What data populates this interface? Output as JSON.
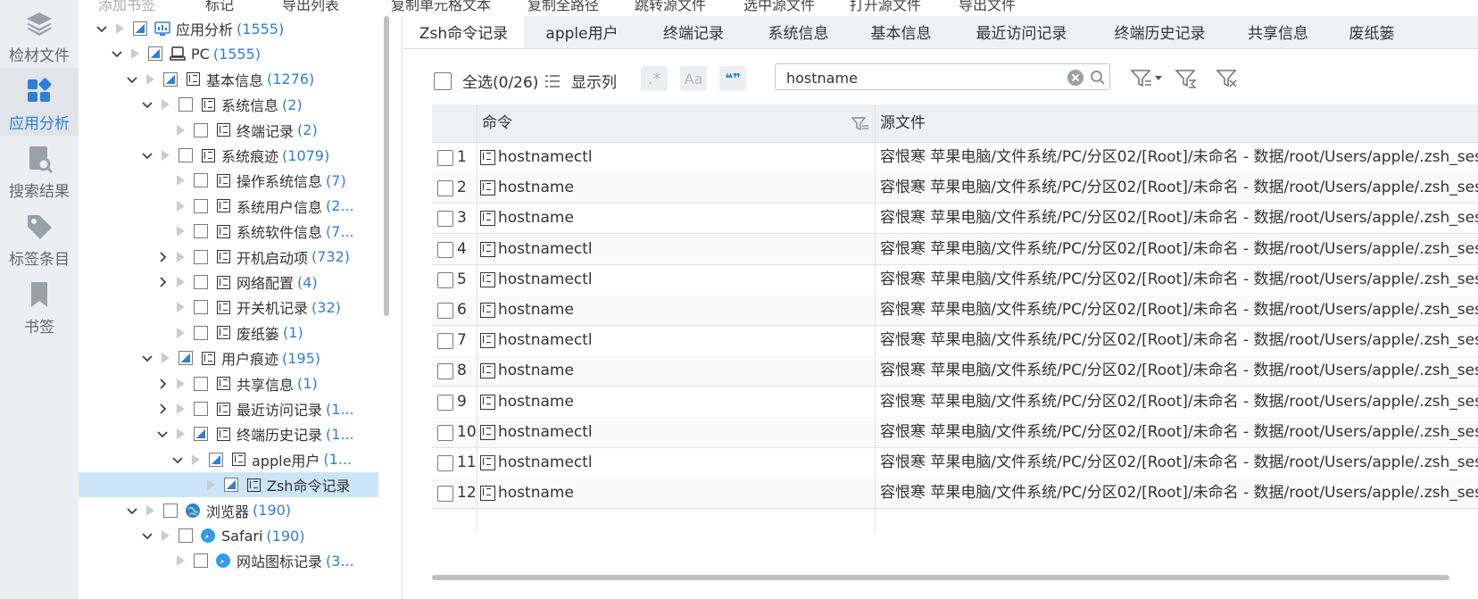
{
  "rail": [
    {
      "label": "检材文件",
      "icon": "layers-icon",
      "active": false
    },
    {
      "label": "应用分析",
      "icon": "grid-apps-icon",
      "active": true
    },
    {
      "label": "搜索结果",
      "icon": "search-doc-icon",
      "active": false
    },
    {
      "label": "标签条目",
      "icon": "tag-icon",
      "active": false
    },
    {
      "label": "书签",
      "icon": "bookmark-icon",
      "active": false
    }
  ],
  "top_menu": [
    "添加书签",
    "标记",
    "导出列表",
    "复制单元格文本",
    "复制全路径",
    "跳转源文件",
    "选中源文件",
    "打开源文件",
    "导出文件"
  ],
  "tree": [
    {
      "indent": 0,
      "expander": "down",
      "check": "partial",
      "icon": "app-analysis-icon",
      "label": "应用分析",
      "count": "(1555)"
    },
    {
      "indent": 1,
      "expander": "down",
      "check": "partial",
      "icon": "pc-icon",
      "label": "PC",
      "count": "(1555)"
    },
    {
      "indent": 2,
      "expander": "down",
      "check": "partial",
      "icon": "table-icon",
      "label": "基本信息",
      "count": "(1276)"
    },
    {
      "indent": 3,
      "expander": "down",
      "check": "none",
      "icon": "table-icon",
      "label": "系统信息",
      "count": "(2)"
    },
    {
      "indent": 4,
      "expander": "none",
      "check": "none",
      "icon": "table-icon",
      "label": "终端记录",
      "count": "(2)"
    },
    {
      "indent": 3,
      "expander": "down",
      "check": "none",
      "icon": "table-icon",
      "label": "系统痕迹",
      "count": "(1079)"
    },
    {
      "indent": 4,
      "expander": "none",
      "check": "none",
      "icon": "table-icon",
      "label": "操作系统信息",
      "count": "(7)"
    },
    {
      "indent": 4,
      "expander": "none",
      "check": "none",
      "icon": "table-icon",
      "label": "系统用户信息",
      "count": "(2..."
    },
    {
      "indent": 4,
      "expander": "none",
      "check": "none",
      "icon": "table-icon",
      "label": "系统软件信息",
      "count": "(7..."
    },
    {
      "indent": 4,
      "expander": "right",
      "check": "none",
      "icon": "table-icon",
      "label": "开机启动项",
      "count": "(732)"
    },
    {
      "indent": 4,
      "expander": "right",
      "check": "none",
      "icon": "table-icon",
      "label": "网络配置",
      "count": "(4)"
    },
    {
      "indent": 4,
      "expander": "none",
      "check": "none",
      "icon": "table-icon",
      "label": "开关机记录",
      "count": "(32)"
    },
    {
      "indent": 4,
      "expander": "none",
      "check": "none",
      "icon": "table-icon",
      "label": "废纸篓",
      "count": "(1)"
    },
    {
      "indent": 3,
      "expander": "down",
      "check": "partial",
      "icon": "table-icon",
      "label": "用户痕迹",
      "count": "(195)"
    },
    {
      "indent": 4,
      "expander": "right",
      "check": "none",
      "icon": "table-icon",
      "label": "共享信息",
      "count": "(1)"
    },
    {
      "indent": 4,
      "expander": "right",
      "check": "none",
      "icon": "table-icon",
      "label": "最近访问记录",
      "count": "(1..."
    },
    {
      "indent": 4,
      "expander": "down",
      "check": "partial",
      "icon": "table-icon",
      "label": "终端历史记录",
      "count": "(1..."
    },
    {
      "indent": 5,
      "expander": "down",
      "check": "partial",
      "icon": "table-icon",
      "label": "apple用户",
      "count": "(1..."
    },
    {
      "indent": 6,
      "expander": "none",
      "check": "partial",
      "icon": "table-icon",
      "label": "Zsh命令记录",
      "count": "",
      "selected": true
    },
    {
      "indent": 2,
      "expander": "down",
      "check": "none",
      "icon": "globe-icon",
      "label": "浏览器",
      "count": "(190)"
    },
    {
      "indent": 3,
      "expander": "down",
      "check": "none",
      "icon": "safari-icon",
      "label": "Safari",
      "count": "(190)"
    },
    {
      "indent": 4,
      "expander": "none",
      "check": "none",
      "icon": "safari-icon",
      "label": "网站图标记录",
      "count": "(3..."
    }
  ],
  "tabs": [
    "Zsh命令记录",
    "apple用户",
    "终端记录",
    "系统信息",
    "基本信息",
    "最近访问记录",
    "终端历史记录",
    "共享信息",
    "废纸篓"
  ],
  "active_tab": 0,
  "toolbar": {
    "select_all": "全选(0/26)",
    "show_columns": "显示列",
    "regex_glyph": ".*",
    "case_glyph": "Aa",
    "word_glyph": "❝❞"
  },
  "search": {
    "value": "hostname",
    "placeholder": ""
  },
  "grid": {
    "col_cmd": "命令",
    "col_src": "源文件",
    "rows": [
      {
        "n": "1",
        "cmd": "hostnamectl",
        "src": "容恨寒 苹果电脑/文件系统/PC/分区02/[Root]/未命名 - 数据/root/Users/apple/.zsh_sessio"
      },
      {
        "n": "2",
        "cmd": "hostname",
        "src": "容恨寒 苹果电脑/文件系统/PC/分区02/[Root]/未命名 - 数据/root/Users/apple/.zsh_sessio"
      },
      {
        "n": "3",
        "cmd": "hostname",
        "src": "容恨寒 苹果电脑/文件系统/PC/分区02/[Root]/未命名 - 数据/root/Users/apple/.zsh_sessio"
      },
      {
        "n": "4",
        "cmd": "hostnamectl",
        "src": "容恨寒 苹果电脑/文件系统/PC/分区02/[Root]/未命名 - 数据/root/Users/apple/.zsh_sessio"
      },
      {
        "n": "5",
        "cmd": "hostnamectl",
        "src": "容恨寒 苹果电脑/文件系统/PC/分区02/[Root]/未命名 - 数据/root/Users/apple/.zsh_sessio"
      },
      {
        "n": "6",
        "cmd": "hostname",
        "src": "容恨寒 苹果电脑/文件系统/PC/分区02/[Root]/未命名 - 数据/root/Users/apple/.zsh_sessio"
      },
      {
        "n": "7",
        "cmd": "hostnamectl",
        "src": "容恨寒 苹果电脑/文件系统/PC/分区02/[Root]/未命名 - 数据/root/Users/apple/.zsh_sessio"
      },
      {
        "n": "8",
        "cmd": "hostname",
        "src": "容恨寒 苹果电脑/文件系统/PC/分区02/[Root]/未命名 - 数据/root/Users/apple/.zsh_sessio"
      },
      {
        "n": "9",
        "cmd": "hostname",
        "src": "容恨寒 苹果电脑/文件系统/PC/分区02/[Root]/未命名 - 数据/root/Users/apple/.zsh_sessio"
      },
      {
        "n": "10",
        "cmd": "hostnamectl",
        "src": "容恨寒 苹果电脑/文件系统/PC/分区02/[Root]/未命名 - 数据/root/Users/apple/.zsh_sessio"
      },
      {
        "n": "11",
        "cmd": "hostnamectl",
        "src": "容恨寒 苹果电脑/文件系统/PC/分区02/[Root]/未命名 - 数据/root/Users/apple/.zsh_sessio"
      },
      {
        "n": "12",
        "cmd": "hostname",
        "src": "容恨寒 苹果电脑/文件系统/PC/分区02/[Root]/未命名 - 数据/root/Users/apple/.zsh_sessio"
      }
    ]
  },
  "colors": {
    "accent": "#2f7fd7",
    "selection": "#cce4f7",
    "rail_bg": "#eceef1",
    "header_bg": "#eef0f3"
  }
}
